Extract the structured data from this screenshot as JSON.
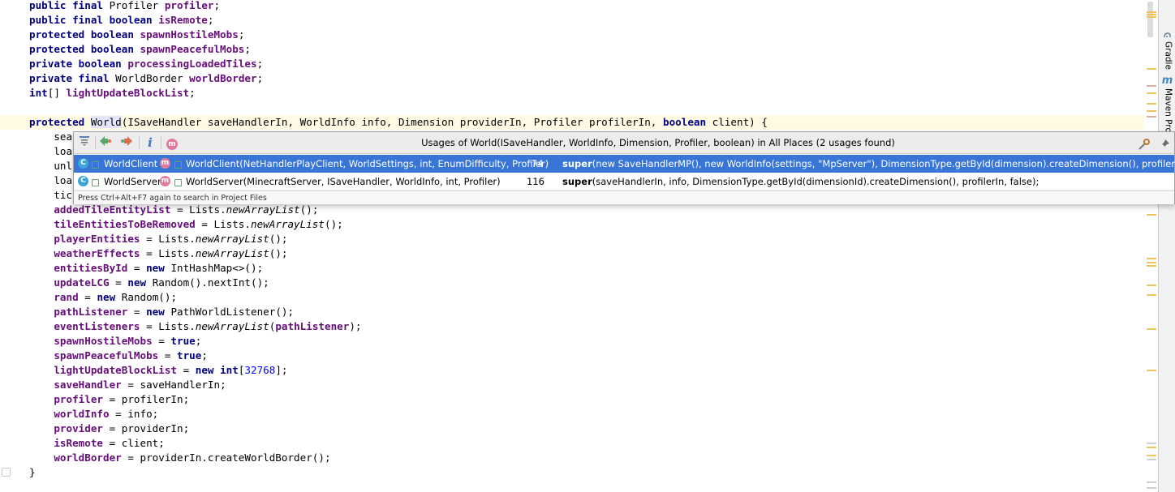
{
  "editor": {
    "lines": [
      {
        "parts": [
          {
            "t": "public final ",
            "c": "kw"
          },
          {
            "t": "Profiler "
          },
          {
            "t": "profiler",
            "c": "fld"
          },
          {
            "t": ";"
          }
        ]
      },
      {
        "parts": [
          {
            "t": "public final boolean ",
            "c": "kw"
          },
          {
            "t": "isRemote",
            "c": "fld"
          },
          {
            "t": ";"
          }
        ]
      },
      {
        "parts": [
          {
            "t": "protected boolean ",
            "c": "kw"
          },
          {
            "t": "spawnHostileMobs",
            "c": "fld"
          },
          {
            "t": ";"
          }
        ]
      },
      {
        "parts": [
          {
            "t": "protected boolean ",
            "c": "kw"
          },
          {
            "t": "spawnPeacefulMobs",
            "c": "fld"
          },
          {
            "t": ";"
          }
        ]
      },
      {
        "parts": [
          {
            "t": "private boolean ",
            "c": "kw"
          },
          {
            "t": "processingLoadedTiles",
            "c": "fld"
          },
          {
            "t": ";"
          }
        ]
      },
      {
        "parts": [
          {
            "t": "private final ",
            "c": "kw"
          },
          {
            "t": "WorldBorder "
          },
          {
            "t": "worldBorder",
            "c": "fld"
          },
          {
            "t": ";"
          }
        ]
      },
      {
        "parts": [
          {
            "t": "int",
            "c": "kw"
          },
          {
            "t": "[] "
          },
          {
            "t": "lightUpdateBlockList",
            "c": "fld"
          },
          {
            "t": ";"
          }
        ]
      },
      {
        "parts": []
      },
      {
        "parts": [
          {
            "t": "protected ",
            "c": "kw"
          },
          {
            "t": "World",
            "c": "hl-ident"
          },
          {
            "t": "(ISaveHandler saveHandlerIn, WorldInfo info, Dimension providerIn, Profiler profilerIn, "
          },
          {
            "t": "boolean ",
            "c": "kw"
          },
          {
            "t": "client) {"
          }
        ],
        "caret": true
      },
      {
        "parts": [
          {
            "t": "    sea"
          }
        ]
      },
      {
        "parts": [
          {
            "t": "    loa"
          }
        ]
      },
      {
        "parts": [
          {
            "t": "    unl"
          }
        ]
      },
      {
        "parts": [
          {
            "t": "    loa"
          }
        ]
      },
      {
        "parts": [
          {
            "t": "    tic"
          }
        ]
      },
      {
        "parts": [
          {
            "t": "    "
          },
          {
            "t": "addedTileEntityList",
            "c": "fld"
          },
          {
            "t": " = Lists."
          },
          {
            "t": "newArrayList",
            "c": "mth-i"
          },
          {
            "t": "();"
          }
        ]
      },
      {
        "parts": [
          {
            "t": "    "
          },
          {
            "t": "tileEntitiesToBeRemoved",
            "c": "fld"
          },
          {
            "t": " = Lists."
          },
          {
            "t": "newArrayList",
            "c": "mth-i"
          },
          {
            "t": "();"
          }
        ]
      },
      {
        "parts": [
          {
            "t": "    "
          },
          {
            "t": "playerEntities",
            "c": "fld"
          },
          {
            "t": " = Lists."
          },
          {
            "t": "newArrayList",
            "c": "mth-i"
          },
          {
            "t": "();"
          }
        ]
      },
      {
        "parts": [
          {
            "t": "    "
          },
          {
            "t": "weatherEffects",
            "c": "fld"
          },
          {
            "t": " = Lists."
          },
          {
            "t": "newArrayList",
            "c": "mth-i"
          },
          {
            "t": "();"
          }
        ]
      },
      {
        "parts": [
          {
            "t": "    "
          },
          {
            "t": "entitiesById",
            "c": "fld"
          },
          {
            "t": " = "
          },
          {
            "t": "new ",
            "c": "kw"
          },
          {
            "t": "IntHashMap<>();"
          }
        ]
      },
      {
        "parts": [
          {
            "t": "    "
          },
          {
            "t": "updateLCG",
            "c": "fld"
          },
          {
            "t": " = "
          },
          {
            "t": "new ",
            "c": "kw"
          },
          {
            "t": "Random().nextInt();"
          }
        ]
      },
      {
        "parts": [
          {
            "t": "    "
          },
          {
            "t": "rand",
            "c": "fld"
          },
          {
            "t": " = "
          },
          {
            "t": "new ",
            "c": "kw"
          },
          {
            "t": "Random();"
          }
        ]
      },
      {
        "parts": [
          {
            "t": "    "
          },
          {
            "t": "pathListener",
            "c": "fld"
          },
          {
            "t": " = "
          },
          {
            "t": "new ",
            "c": "kw"
          },
          {
            "t": "PathWorldListener();"
          }
        ]
      },
      {
        "parts": [
          {
            "t": "    "
          },
          {
            "t": "eventListeners",
            "c": "fld"
          },
          {
            "t": " = Lists."
          },
          {
            "t": "newArrayList",
            "c": "mth-i"
          },
          {
            "t": "("
          },
          {
            "t": "pathListener",
            "c": "fld"
          },
          {
            "t": ");"
          }
        ]
      },
      {
        "parts": [
          {
            "t": "    "
          },
          {
            "t": "spawnHostileMobs",
            "c": "fld"
          },
          {
            "t": " = "
          },
          {
            "t": "true",
            "c": "kw"
          },
          {
            "t": ";"
          }
        ]
      },
      {
        "parts": [
          {
            "t": "    "
          },
          {
            "t": "spawnPeacefulMobs",
            "c": "fld"
          },
          {
            "t": " = "
          },
          {
            "t": "true",
            "c": "kw"
          },
          {
            "t": ";"
          }
        ]
      },
      {
        "parts": [
          {
            "t": "    "
          },
          {
            "t": "lightUpdateBlockList",
            "c": "fld"
          },
          {
            "t": " = "
          },
          {
            "t": "new int",
            "c": "kw"
          },
          {
            "t": "["
          },
          {
            "t": "32768",
            "c": "num"
          },
          {
            "t": "];"
          }
        ]
      },
      {
        "parts": [
          {
            "t": "    "
          },
          {
            "t": "saveHandler",
            "c": "fld"
          },
          {
            "t": " = saveHandlerIn;"
          }
        ]
      },
      {
        "parts": [
          {
            "t": "    "
          },
          {
            "t": "profiler",
            "c": "fld"
          },
          {
            "t": " = profilerIn;"
          }
        ]
      },
      {
        "parts": [
          {
            "t": "    "
          },
          {
            "t": "worldInfo",
            "c": "fld"
          },
          {
            "t": " = info;"
          }
        ]
      },
      {
        "parts": [
          {
            "t": "    "
          },
          {
            "t": "provider",
            "c": "fld"
          },
          {
            "t": " = providerIn;"
          }
        ]
      },
      {
        "parts": [
          {
            "t": "    "
          },
          {
            "t": "isRemote",
            "c": "fld"
          },
          {
            "t": " = client;"
          }
        ]
      },
      {
        "parts": [
          {
            "t": "    "
          },
          {
            "t": "worldBorder",
            "c": "fld"
          },
          {
            "t": " = providerIn.createWorldBorder();"
          }
        ]
      },
      {
        "parts": [
          {
            "t": "}"
          }
        ]
      }
    ]
  },
  "popup": {
    "title": "Usages of World(ISaveHandler, WorldInfo, Dimension, Profiler, boolean) in All Places (2 usages found)",
    "toolbar_icons": [
      "merge-usages-icon",
      "next-occurrence-icon",
      "previous-occurrence-icon",
      "info-icon",
      "method-filter-icon"
    ],
    "info_glyph": "i",
    "method_glyph": "m",
    "results": [
      {
        "class_icon_letter": "C",
        "class_name": "WorldClient",
        "method_icon_letter": "m",
        "method_sig": "WorldClient(NetHandlerPlayClient, WorldSettings, int, EnumDifficulty, Profiler)",
        "line": "74",
        "code_kw": "super",
        "code_rest": "(new SaveHandlerMP(), new WorldInfo(settings, \"MpServer\"), DimensionType.getById(dimension).createDimension(), profilerIn, true);",
        "selected": true
      },
      {
        "class_icon_letter": "C",
        "class_name": "WorldServer",
        "method_icon_letter": "m",
        "method_sig": "WorldServer(MinecraftServer, ISaveHandler, WorldInfo, int, Profiler)",
        "line": "116",
        "code_kw": "super",
        "code_rest": "(saveHandlerIn, info, DimensionType.getById(dimensionId).createDimension(), profilerIn, false);",
        "selected": false
      }
    ],
    "hint": "Press Ctrl+Alt+F7 again to search in Project Files"
  },
  "tool_window_bar": {
    "gradle_label": "Gradle",
    "maven_label": "Maven Pro",
    "maven_glyph": "m"
  },
  "colors": {
    "keyword": "#000080",
    "field": "#660e7a",
    "selection": "#3875d7",
    "caret_row": "#fffae3"
  }
}
